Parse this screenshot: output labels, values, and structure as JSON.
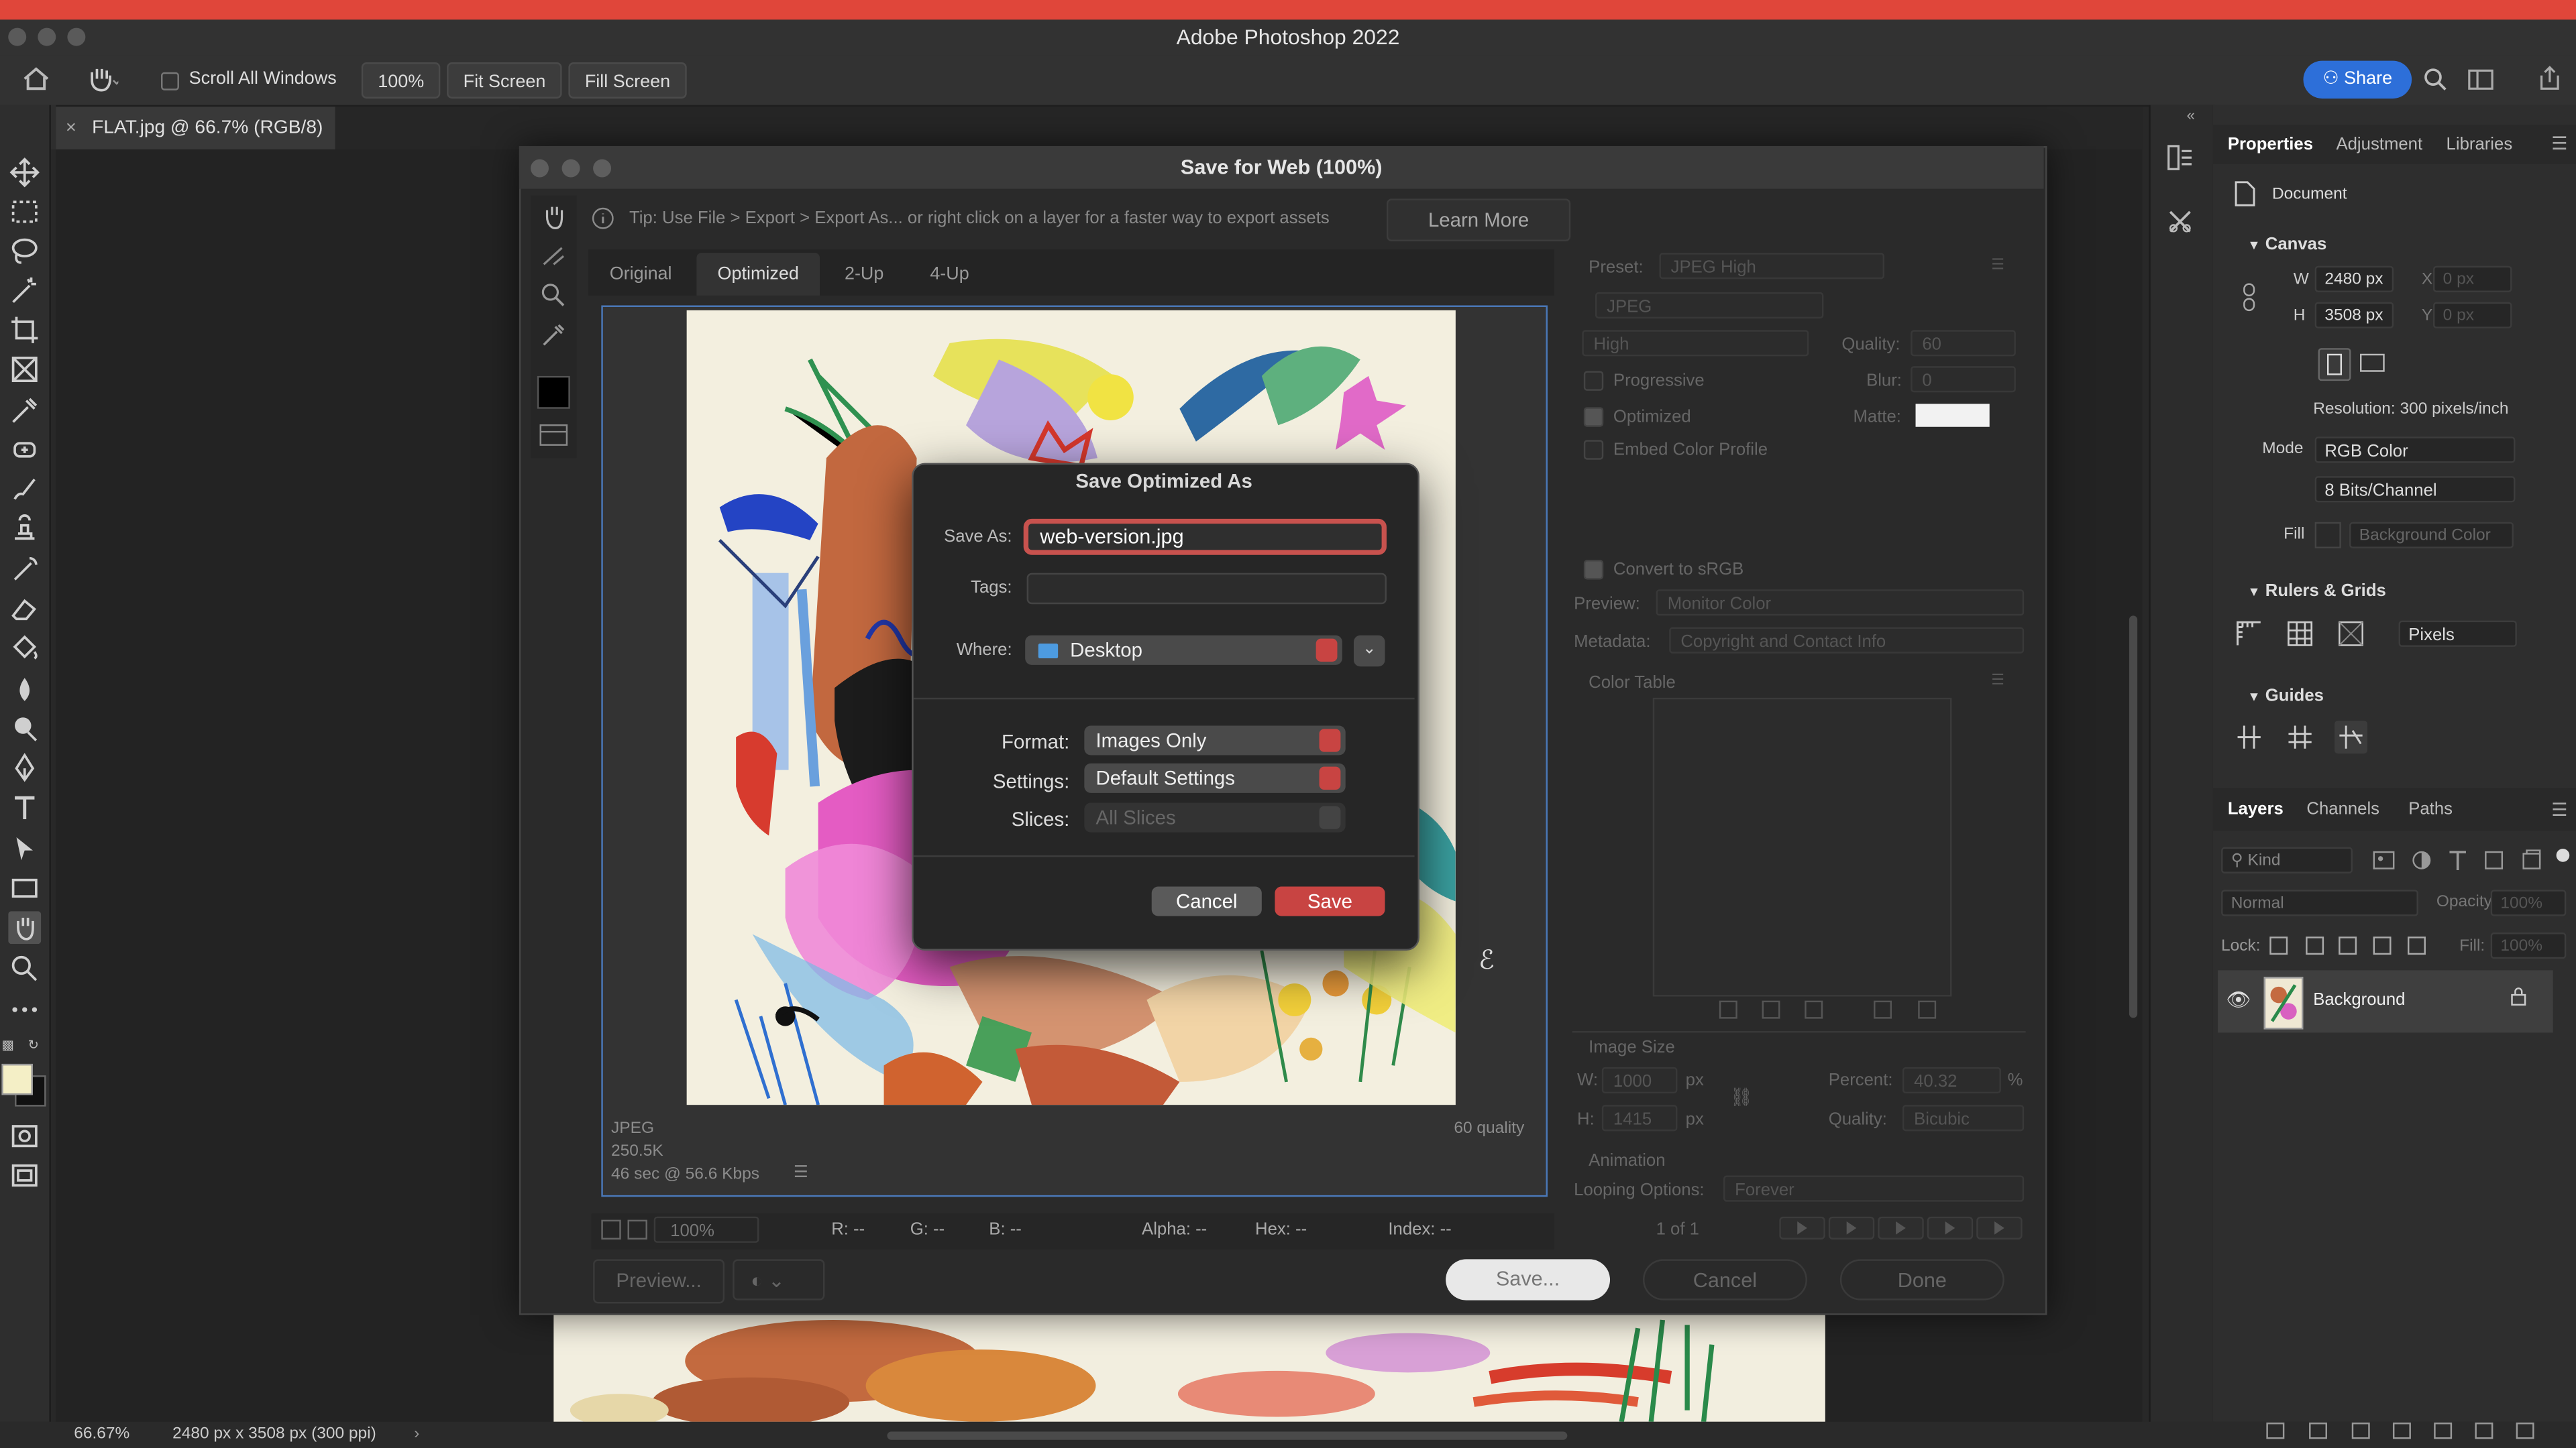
{
  "app": {
    "title": "Adobe Photoshop 2022",
    "share_label": "Share"
  },
  "options_bar": {
    "scroll_all_windows": "Scroll All Windows",
    "zoom": "100%",
    "fit_screen": "Fit Screen",
    "fill_screen": "Fill Screen"
  },
  "document": {
    "tab": "FLAT.jpg @ 66.7% (RGB/8)"
  },
  "status": {
    "zoom": "66.67%",
    "size": "2480 px x 3508 px (300 ppi)"
  },
  "save_for_web": {
    "title": "Save for Web (100%)",
    "tip": "Tip: Use File > Export > Export As...  or right click on a layer for a faster way to export assets",
    "learn_more": "Learn More",
    "tabs": [
      "Original",
      "Optimized",
      "2-Up",
      "4-Up"
    ],
    "active_tab": "Optimized",
    "preview_info": {
      "format": "JPEG",
      "size": "250.5K",
      "speed": "46 sec @ 56.6 Kbps",
      "quality": "60 quality"
    },
    "bottom": {
      "zoom": "100%",
      "r": "R: --",
      "g": "G: --",
      "b": "B: --",
      "alpha": "Alpha: --",
      "hex": "Hex: --",
      "index": "Index: --"
    },
    "preview_button": "Preview...",
    "save_button": "Save...",
    "cancel_button": "Cancel",
    "done_button": "Done",
    "settings": {
      "preset_label": "Preset:",
      "preset": "JPEG High",
      "format": "JPEG",
      "compression": "High",
      "quality_label": "Quality:",
      "quality": "60",
      "progressive": "Progressive",
      "blur_label": "Blur:",
      "blur": "0",
      "optimized": "Optimized",
      "matte_label": "Matte:",
      "embed_profile": "Embed Color Profile",
      "convert_srgb": "Convert to sRGB",
      "preview_label": "Preview:",
      "preview": "Monitor Color",
      "metadata_label": "Metadata:",
      "metadata": "Copyright and Contact Info",
      "color_table": "Color Table",
      "image_size": "Image Size",
      "w_label": "W:",
      "w": "1000",
      "h_label": "H:",
      "h": "1415",
      "px": "px",
      "percent_label": "Percent:",
      "percent": "40.32",
      "percent_sign": "%",
      "resample_quality_label": "Quality:",
      "resample_quality": "Bicubic",
      "animation": "Animation",
      "looping_label": "Looping Options:",
      "looping": "Forever",
      "frame": "1 of 1"
    }
  },
  "save_dialog": {
    "title": "Save Optimized As",
    "save_as_label": "Save As:",
    "save_as_value": "web-version.jpg",
    "tags_label": "Tags:",
    "where_label": "Where:",
    "where_value": "Desktop",
    "format_label": "Format:",
    "format_value": "Images Only",
    "settings_label": "Settings:",
    "settings_value": "Default Settings",
    "slices_label": "Slices:",
    "slices_value": "All Slices",
    "cancel": "Cancel",
    "save": "Save"
  },
  "properties_panel": {
    "tabs": [
      "Properties",
      "Adjustment",
      "Libraries"
    ],
    "document_label": "Document",
    "canvas_header": "Canvas",
    "w_label": "W",
    "w_value": "2480 px",
    "h_label": "H",
    "h_value": "3508 px",
    "x_label": "X",
    "x_value": "0 px",
    "y_label": "Y",
    "y_value": "0 px",
    "resolution": "Resolution: 300 pixels/inch",
    "mode_label": "Mode",
    "mode_value": "RGB Color",
    "bits_value": "8 Bits/Channel",
    "fill_label": "Fill",
    "fill_value": "Background Color",
    "rulers_header": "Rulers & Grids",
    "units": "Pixels",
    "guides_header": "Guides"
  },
  "layers_panel": {
    "tabs": [
      "Layers",
      "Channels",
      "Paths"
    ],
    "kind": "Kind",
    "blend": "Normal",
    "opacity_label": "Opacity:",
    "opacity": "100%",
    "lock_label": "Lock:",
    "fill_label": "Fill:",
    "fill": "100%",
    "layer_name": "Background"
  },
  "colors": {
    "accent_red": "#c84442",
    "share_blue": "#2d6fd9",
    "titlebar_red": "#e0463a"
  }
}
